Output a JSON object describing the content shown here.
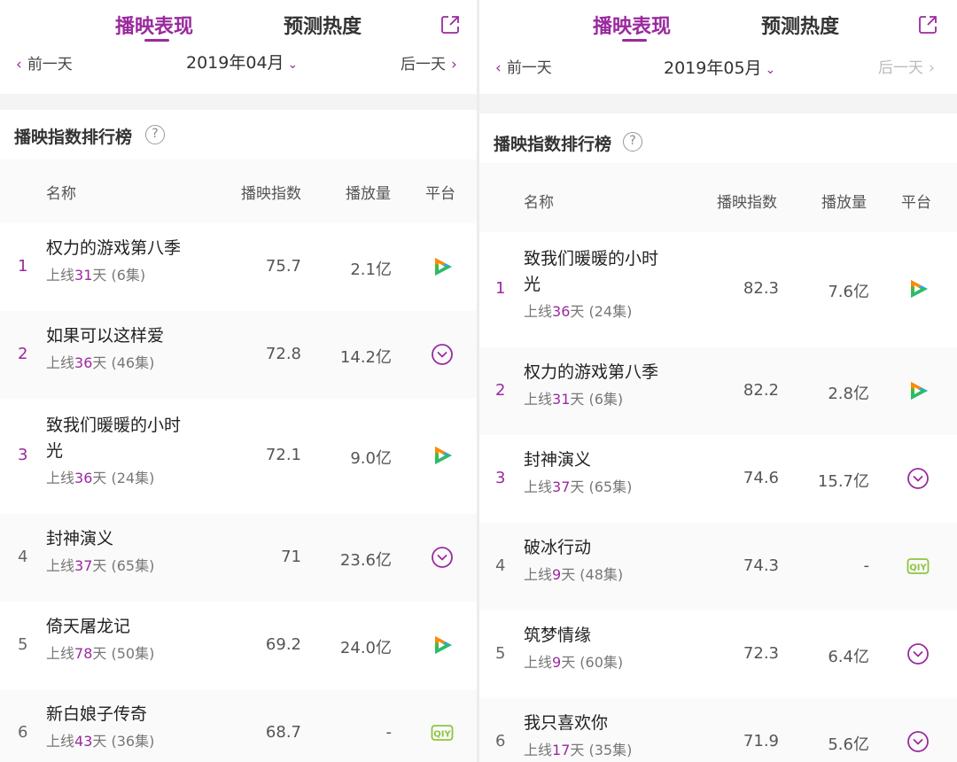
{
  "left": {
    "tabs": {
      "active": "播映表现",
      "other": "预测热度"
    },
    "datebar": {
      "prev": "前一天",
      "month": "2019年04月",
      "next": "后一天"
    },
    "section_title": "播映指数排行榜",
    "headers": {
      "name": "名称",
      "index": "播映指数",
      "plays": "播放量",
      "platform": "平台"
    },
    "rows": [
      {
        "rank": "1",
        "title_lines": [
          "权力的游戏第八季"
        ],
        "pre": "上线",
        "days": "31",
        "suffix": "天 (6集)",
        "index": "75.7",
        "plays": "2.1亿",
        "platform": "tencent-video-icon"
      },
      {
        "rank": "2",
        "title_lines": [
          "如果可以这样爱"
        ],
        "pre": "上线",
        "days": "36",
        "suffix": "天 (46集)",
        "index": "72.8",
        "plays": "14.2亿",
        "platform": "youku-icon"
      },
      {
        "rank": "3",
        "title_lines": [
          "致我们暖暖的小时",
          "光"
        ],
        "pre": "上线",
        "days": "36",
        "suffix": "天 (24集)",
        "index": "72.1",
        "plays": "9.0亿",
        "platform": "tencent-video-icon"
      },
      {
        "rank": "4",
        "title_lines": [
          "封神演义"
        ],
        "pre": "上线",
        "days": "37",
        "suffix": "天 (65集)",
        "index": "71",
        "plays": "23.6亿",
        "platform": "youku-icon"
      },
      {
        "rank": "5",
        "title_lines": [
          "倚天屠龙记"
        ],
        "pre": "上线",
        "days": "78",
        "suffix": "天 (50集)",
        "index": "69.2",
        "plays": "24.0亿",
        "platform": "tencent-video-icon"
      },
      {
        "rank": "6",
        "title_lines": [
          "新白娘子传奇"
        ],
        "pre": "上线",
        "days": "43",
        "suffix": "天 (36集)",
        "index": "68.7",
        "plays": "-",
        "platform": "iqiyi-icon"
      }
    ]
  },
  "right": {
    "tabs": {
      "active": "播映表现",
      "other": "预测热度"
    },
    "datebar": {
      "prev": "前一天",
      "month": "2019年05月",
      "next": "后一天"
    },
    "section_title": "播映指数排行榜",
    "headers": {
      "name": "名称",
      "index": "播映指数",
      "plays": "播放量",
      "platform": "平台"
    },
    "rows": [
      {
        "rank": "1",
        "title_lines": [
          "致我们暖暖的小时",
          "光"
        ],
        "pre": "上线",
        "days": "36",
        "suffix": "天 (24集)",
        "index": "82.3",
        "plays": "7.6亿",
        "platform": "tencent-video-icon"
      },
      {
        "rank": "2",
        "title_lines": [
          "权力的游戏第八季"
        ],
        "pre": "上线",
        "days": "31",
        "suffix": "天 (6集)",
        "index": "82.2",
        "plays": "2.8亿",
        "platform": "tencent-video-icon"
      },
      {
        "rank": "3",
        "title_lines": [
          "封神演义"
        ],
        "pre": "上线",
        "days": "37",
        "suffix": "天 (65集)",
        "index": "74.6",
        "plays": "15.7亿",
        "platform": "youku-icon"
      },
      {
        "rank": "4",
        "title_lines": [
          "破冰行动"
        ],
        "pre": "上线",
        "days": "9",
        "suffix": "天 (48集)",
        "index": "74.3",
        "plays": "-",
        "platform": "iqiyi-icon"
      },
      {
        "rank": "5",
        "title_lines": [
          "筑梦情缘"
        ],
        "pre": "上线",
        "days": "9",
        "suffix": "天 (60集)",
        "index": "72.3",
        "plays": "6.4亿",
        "platform": "youku-icon"
      },
      {
        "rank": "6",
        "title_lines": [
          "我只喜欢你"
        ],
        "pre": "上线",
        "days": "17",
        "suffix": "天 (35集)",
        "index": "71.9",
        "plays": "5.6亿",
        "platform": "youku-icon"
      }
    ]
  },
  "colors": {
    "accent": "#9a2a9e",
    "iqiyi": "#8cc63f",
    "tencent_blue": "#2aa4f4",
    "tencent_orange": "#ff8a00",
    "tencent_green": "#2fbf4a"
  }
}
